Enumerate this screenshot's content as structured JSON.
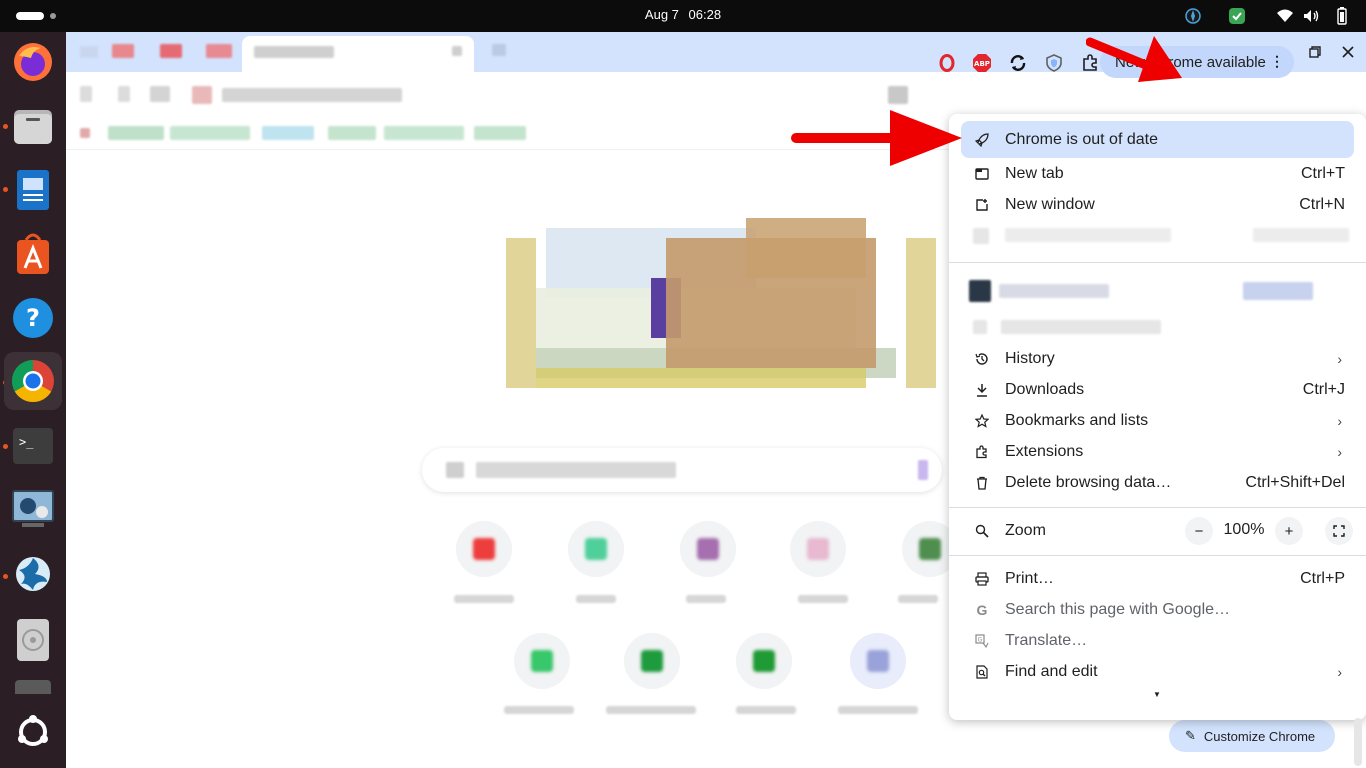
{
  "topbar": {
    "date": "Aug 7",
    "time": "06:28"
  },
  "dock": {
    "apps": [
      {
        "name": "firefox",
        "icon": "firefox-icon"
      },
      {
        "name": "files",
        "icon": "files-icon"
      },
      {
        "name": "writer",
        "icon": "document-icon"
      },
      {
        "name": "app-center",
        "icon": "app-store-icon"
      },
      {
        "name": "help",
        "icon": "help-icon"
      },
      {
        "name": "chrome",
        "icon": "chrome-icon"
      },
      {
        "name": "terminal",
        "icon": "terminal-icon",
        "glyph": ">_"
      },
      {
        "name": "media",
        "icon": "media-icon"
      },
      {
        "name": "shutter",
        "icon": "shutter-icon"
      },
      {
        "name": "disc",
        "icon": "disc-icon"
      },
      {
        "name": "ubuntu",
        "icon": "ubuntu-icon"
      }
    ]
  },
  "toolbar": {
    "update_chip": "New Chrome available",
    "extensions": [
      {
        "icon": "opera-icon",
        "color": "#e3262e"
      },
      {
        "icon": "adblock-icon",
        "glyph": "ABP",
        "color": "#e3262e"
      },
      {
        "icon": "sync-icon",
        "color": "#111111"
      },
      {
        "icon": "shield-icon",
        "color": "#5f6368"
      },
      {
        "icon": "puzzle-icon",
        "color": "#1f1f1f"
      },
      {
        "icon": "profile-icon",
        "color": "#1b2a3a"
      }
    ]
  },
  "menu": {
    "out_of_date": "Chrome is out of date",
    "new_tab": {
      "label": "New tab",
      "shortcut": "Ctrl+T"
    },
    "new_window": {
      "label": "New window",
      "shortcut": "Ctrl+N"
    },
    "history": "History",
    "downloads": {
      "label": "Downloads",
      "shortcut": "Ctrl+J"
    },
    "bookmarks": "Bookmarks and lists",
    "extensions": "Extensions",
    "delete_data": {
      "label": "Delete browsing data…",
      "shortcut": "Ctrl+Shift+Del"
    },
    "zoom": {
      "label": "Zoom",
      "value": "100%",
      "minus": "−",
      "plus": "+"
    },
    "print": {
      "label": "Print…",
      "shortcut": "Ctrl+P"
    },
    "search_page": "Search this page with Google…",
    "translate": "Translate…",
    "find_edit": "Find and edit"
  },
  "ntp": {
    "customize": "Customize Chrome"
  },
  "colors": {
    "accent": "#d3e3fd",
    "chip": "#c2d7fb",
    "arrow": "#ee0000"
  }
}
